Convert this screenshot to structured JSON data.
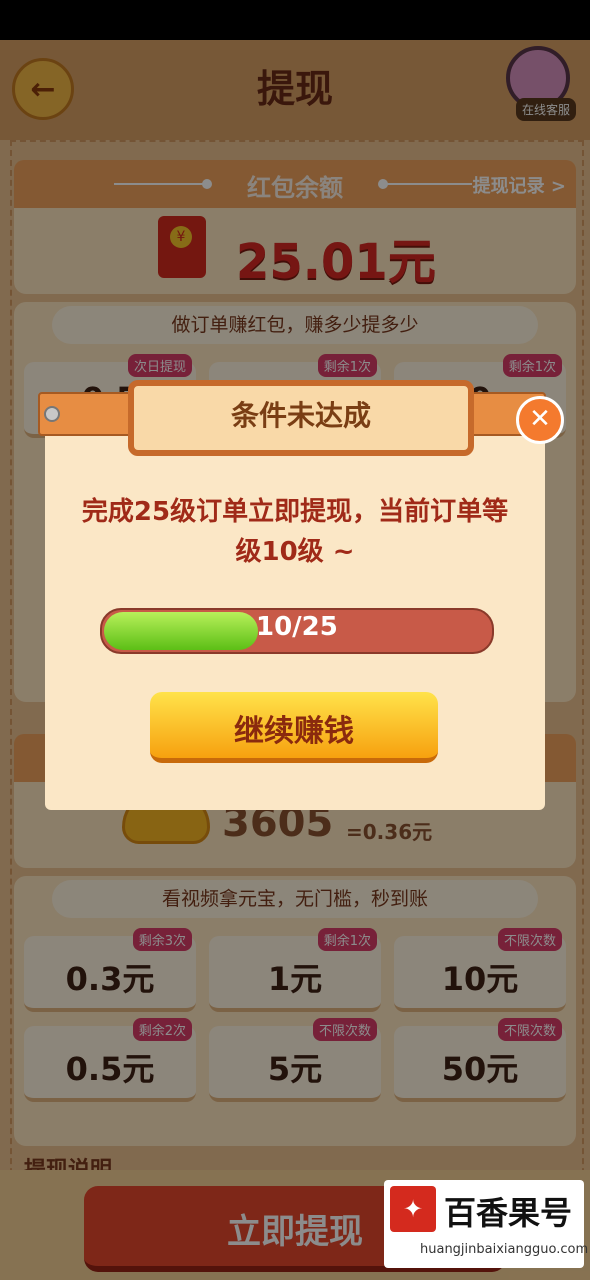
{
  "header": {
    "back_icon": "back-arrow-icon",
    "title": "提现",
    "customer_service_label": "在线客服"
  },
  "redpack_section": {
    "title": "红包余额",
    "record_link": "提现记录 >",
    "balance": "25.01元",
    "tagline": "做订单赚红包，赚多少提多少",
    "tiles": [
      {
        "amount": "0.5",
        "badge": "次日提现"
      },
      {
        "amount": "",
        "badge": "剩余1次"
      },
      {
        "amount": "0",
        "badge": "剩余1次"
      }
    ]
  },
  "coin_section": {
    "count": "3605",
    "equivalent": "=0.36元",
    "tagline": "看视频拿元宝，无门槛，秒到账",
    "tiles": [
      {
        "amount": "0.3元",
        "badge": "剩余3次"
      },
      {
        "amount": "1元",
        "badge": "剩余1次"
      },
      {
        "amount": "10元",
        "badge": "不限次数"
      },
      {
        "amount": "0.5元",
        "badge": "剩余2次"
      },
      {
        "amount": "5元",
        "badge": "不限次数"
      },
      {
        "amount": "50元",
        "badge": "不限次数"
      }
    ],
    "rules_title": "提现说明"
  },
  "bottom": {
    "withdraw_label": "立即提现"
  },
  "dialog": {
    "title": "条件未达成",
    "message": "完成25级订单立即提现，当前订单等级10级 ~",
    "progress": {
      "current": 10,
      "target": 25,
      "label": "10/25"
    },
    "continue_label": "继续赚钱",
    "close_icon": "close-icon"
  },
  "watermark": {
    "name": "百香果号",
    "url": "huangjinbaixiangguo.com"
  },
  "colors": {
    "accent_red": "#d72924",
    "badge_pink": "#d93c68",
    "progress_green": "#5cbf16",
    "button_yellow": "#ffe34a"
  }
}
